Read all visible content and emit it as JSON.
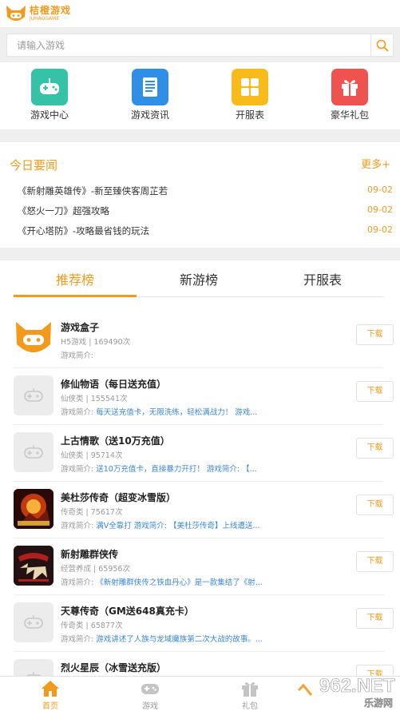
{
  "brand": {
    "name_cn": "桔橙游戏",
    "name_en": "JUHAOGAME",
    "accent": "#f39a1c"
  },
  "search": {
    "placeholder": "请输入游戏"
  },
  "nav": [
    {
      "label": "游戏中心",
      "icon": "gamepad-icon",
      "color": "#35c2a6"
    },
    {
      "label": "游戏资讯",
      "icon": "news-icon",
      "color": "#2f8fe6"
    },
    {
      "label": "开服表",
      "icon": "grid-icon",
      "color": "#f7bb1c"
    },
    {
      "label": "豪华礼包",
      "icon": "gift-icon",
      "color": "#ef5350"
    }
  ],
  "news": {
    "title": "今日要闻",
    "more": "更多+",
    "items": [
      {
        "title": "《新射雕英雄传》-新至臻侠客周芷若",
        "date": "09-02"
      },
      {
        "title": "《怒火一刀》超强攻略",
        "date": "09-02"
      },
      {
        "title": "《开心塔防》-攻略最省钱的玩法",
        "date": "09-02"
      }
    ]
  },
  "tabs": [
    {
      "label": "推荐榜",
      "active": true
    },
    {
      "label": "新游榜",
      "active": false
    },
    {
      "label": "开服表",
      "active": false
    }
  ],
  "games": [
    {
      "name": "游戏盒子",
      "meta": "H5游戏 | 169490次",
      "desc_prefix": "游戏简介:",
      "desc": "",
      "icon": "fox-logo-icon",
      "button": "下载"
    },
    {
      "name": "修仙物语（每日送充值）",
      "meta": "仙侠类 | 155541次",
      "desc_prefix": "游戏简介:",
      "desc": "每天送充值卡，无限洗练，轻松满战力！ 游戏...",
      "icon": "placeholder-gamepad-icon",
      "button": "下载"
    },
    {
      "name": "上古情歌（送10万充值）",
      "meta": "仙侠类 | 95714次",
      "desc_prefix": "游戏简介:",
      "desc": "送10万充值卡，直接暴力开打！ 游戏简介: 【...",
      "icon": "placeholder-gamepad-icon",
      "button": "下载"
    },
    {
      "name": "美杜莎传奇（超变冰雪版）",
      "meta": "传奇类 | 75617次",
      "desc_prefix": "游戏简介:",
      "desc": "满V全靠打 游戏简介: 【美杜莎传奇】上线遭送...",
      "icon": "game-art-icon",
      "button": "下载"
    },
    {
      "name": "新射雕群侠传",
      "meta": "经营养成 | 65956次",
      "desc_prefix": "游戏简介:",
      "desc": "《新射雕群侠传之铁血丹心》是一款集结了《射...",
      "icon": "game-art-icon",
      "button": "下载"
    },
    {
      "name": "天尊传奇（GM送648真充卡）",
      "meta": "传奇类 | 65877次",
      "desc_prefix": "游戏简介:",
      "desc": "游戏讲述了人族与龙域魔族第二次大战的故事。...",
      "icon": "placeholder-gamepad-icon",
      "button": "下载"
    },
    {
      "name": "烈火星辰（冰雪送充版）",
      "meta": "",
      "desc_prefix": "",
      "desc": "",
      "icon": "placeholder-gamepad-icon",
      "button": "下载"
    }
  ],
  "bottom_nav": [
    {
      "label": "首页",
      "icon": "home-icon",
      "active": true
    },
    {
      "label": "游戏",
      "icon": "gamepad-icon",
      "active": false
    },
    {
      "label": "礼包",
      "icon": "gift-icon",
      "active": false
    }
  ],
  "watermark": {
    "text": "962.NET",
    "sub": "乐游网"
  }
}
